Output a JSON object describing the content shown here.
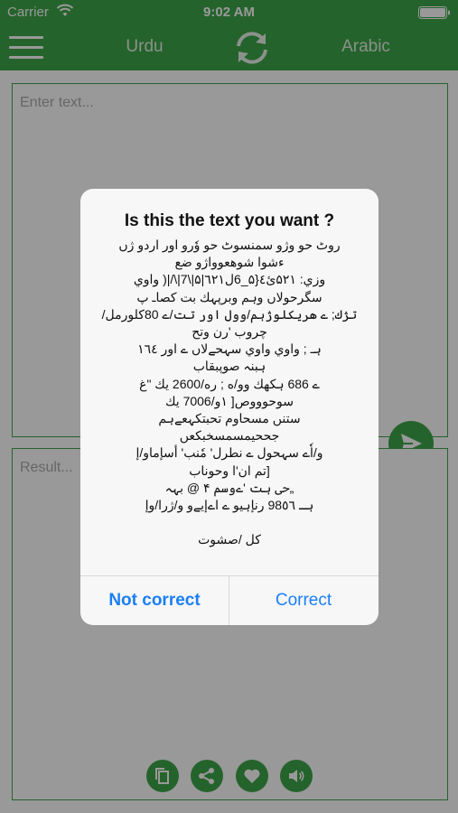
{
  "status_bar": {
    "carrier": "Carrier",
    "time": "9:02 AM"
  },
  "nav": {
    "source_language": "Urdu",
    "target_language": "Arabic"
  },
  "input": {
    "placeholder": "Enter text..."
  },
  "result": {
    "placeholder": "Result..."
  },
  "dialog": {
    "title": "Is this the text you want ?",
    "body": "روٹ حو وژو سمنسوٹ حو وٗرو اور اردو ژں\nءشوا شوهعوواژو ضع\nوزي: ۵۲۱ئ٤{۵_6ل٦٢١|۵|\\7|\\/|( واوي\nسگرحولاں وہم وبرپہك بت  كصاـ پ\nتژك; ے هريكلوژہم/وول اور تت/ے 80كلورمل/\nچروب  'رن وتح\nہـ ; واوي واوي سہحےلاں  ے  اور ١٦٤\nہبنہ صوپبقاب\nے 686 ہكهك وو/ه ; ره/2600 يك \"غ\nسوحوووص[ ١و/7006 يك\nستنں مسحاوم تحبتكہعےہم\nجححیمسمسخبكعں\nو/اٗے سہحول ے نطرل' مٗنب' أسإماو/إ\n[تم ان'ا وحوناب\n„حی ہت 'ےوسم  ۴ @ بہہ\nہـ 98٥٦ رنإہيو ے اےإيےو و/ژرا/وإ\n\nكل /صشوت",
    "not_correct_label": "Not correct",
    "correct_label": "Correct"
  },
  "colors": {
    "brand_green": "#3fa64a",
    "ios_blue": "#1b7ff6"
  }
}
